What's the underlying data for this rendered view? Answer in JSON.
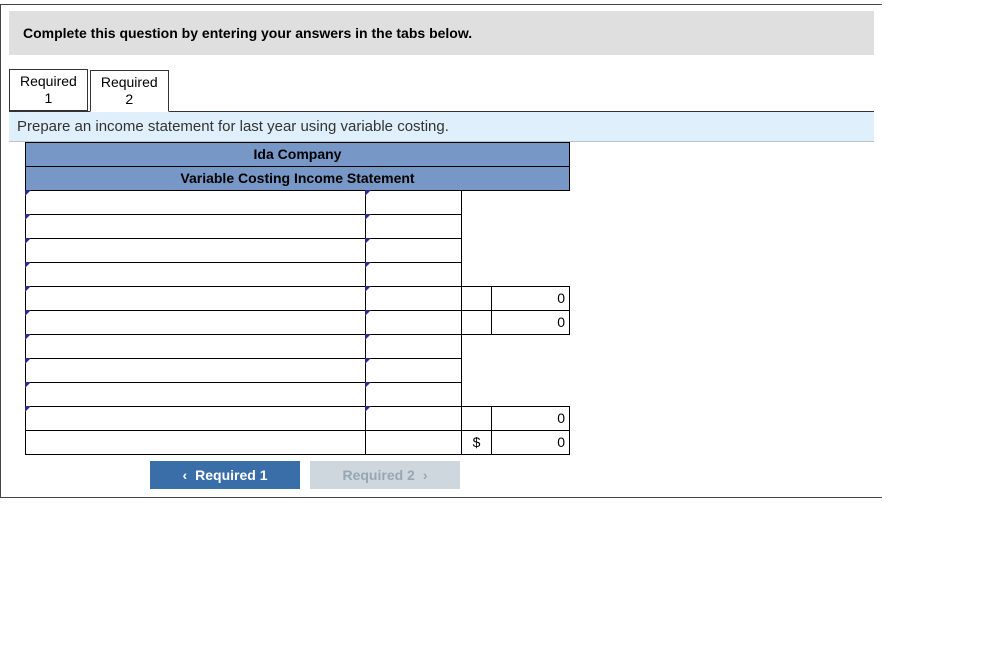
{
  "instruction": "Complete this question by entering your answers in the tabs below.",
  "tabs": {
    "0": {
      "line1": "Required",
      "line2": "1"
    },
    "1": {
      "line1": "Required",
      "line2": "2"
    }
  },
  "subinstruction": "Prepare an income statement for last year using variable costing.",
  "header": {
    "company": "Ida Company",
    "title": "Variable Costing Income Statement"
  },
  "cells": {
    "r5_val": "0",
    "r6_val": "0",
    "r10_val": "0",
    "r11_sym": "$",
    "r11_val": "0"
  },
  "nav": {
    "prev": "Required 1",
    "next": "Required 2"
  }
}
